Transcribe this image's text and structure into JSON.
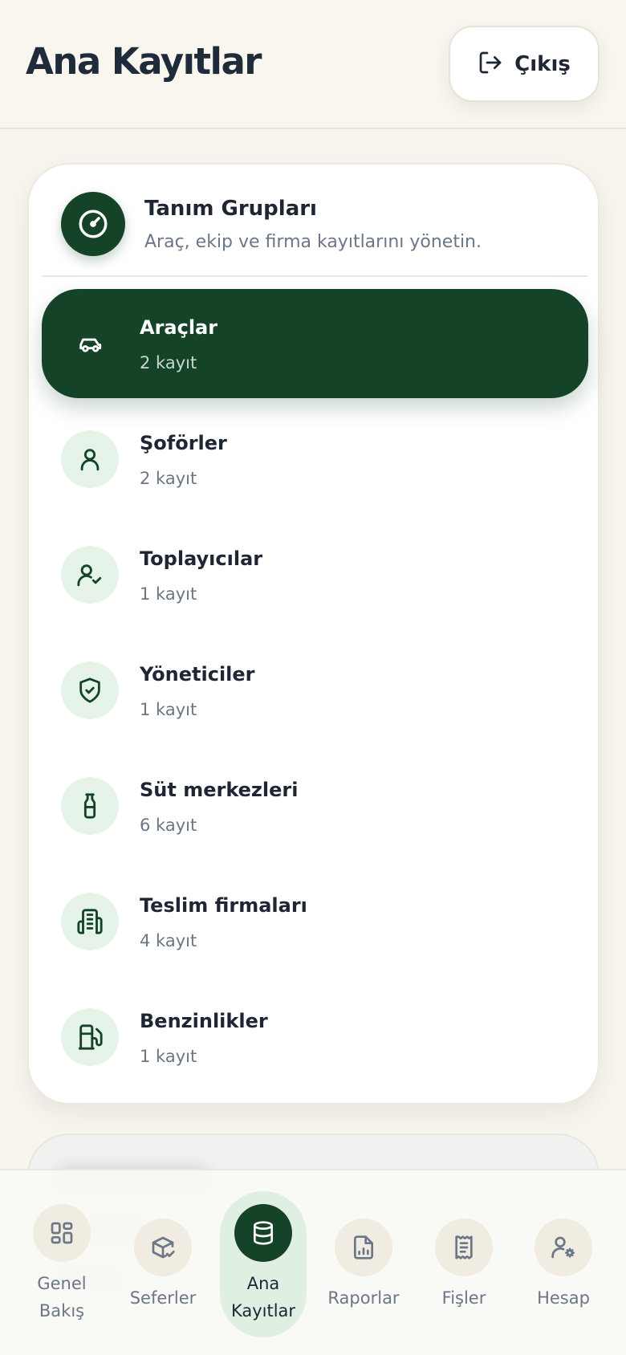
{
  "header": {
    "title": "Ana Kayıtlar",
    "logout_label": "Çıkış",
    "logout_icon": "log-out-icon"
  },
  "card": {
    "icon": "gauge-icon",
    "title": "Tanım Grupları",
    "subtitle": "Araç, ekip ve firma kayıtlarını yönetin.",
    "items": [
      {
        "label": "Araçlar",
        "count": "2 kayıt",
        "icon": "car-icon",
        "active": true
      },
      {
        "label": "Şoförler",
        "count": "2 kayıt",
        "icon": "user-icon",
        "active": false
      },
      {
        "label": "Toplayıcılar",
        "count": "1 kayıt",
        "icon": "user-check-icon",
        "active": false
      },
      {
        "label": "Yöneticiler",
        "count": "1 kayıt",
        "icon": "shield-check-icon",
        "active": false
      },
      {
        "label": "Süt merkezleri",
        "count": "6 kayıt",
        "icon": "milk-bottle-icon",
        "active": false
      },
      {
        "label": "Teslim firmaları",
        "count": "4 kayıt",
        "icon": "building-icon",
        "active": false
      },
      {
        "label": "Benzinlikler",
        "count": "1 kayıt",
        "icon": "fuel-icon",
        "active": false
      }
    ]
  },
  "bottom_nav": {
    "items": [
      {
        "label_line1": "Genel",
        "label_line2": "Bakış",
        "icon": "dashboard-icon",
        "active": false
      },
      {
        "label_line1": "Seferler",
        "label_line2": "",
        "icon": "package-check-icon",
        "active": false
      },
      {
        "label_line1": "Ana",
        "label_line2": "Kayıtlar",
        "icon": "database-icon",
        "active": true
      },
      {
        "label_line1": "Raporlar",
        "label_line2": "",
        "icon": "report-icon",
        "active": false
      },
      {
        "label_line1": "Fişler",
        "label_line2": "",
        "icon": "receipt-icon",
        "active": false
      },
      {
        "label_line1": "Hesap",
        "label_line2": "",
        "icon": "user-cog-icon",
        "active": false
      }
    ]
  },
  "colors": {
    "brand_green": "#144327",
    "icon_bg_green": "#e5f3e8",
    "page_bg": "#f7f5ee",
    "muted_text": "#6b7687"
  }
}
